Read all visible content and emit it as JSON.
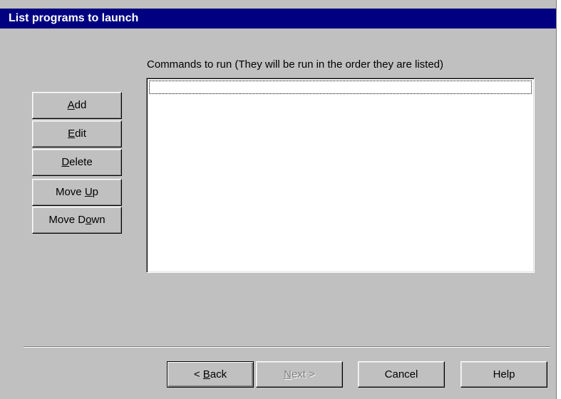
{
  "window": {
    "title": "List programs to launch"
  },
  "side_buttons": [
    {
      "pre": "",
      "ul": "A",
      "post": "dd"
    },
    {
      "pre": "",
      "ul": "E",
      "post": "dit"
    },
    {
      "pre": "",
      "ul": "D",
      "post": "elete"
    },
    {
      "pre": "Move ",
      "ul": "U",
      "post": "p"
    },
    {
      "pre": "Move D",
      "ul": "o",
      "post": "wn"
    }
  ],
  "commands": {
    "label": "Commands to run (They will be run in the order they are listed)",
    "items": []
  },
  "footer": {
    "back": {
      "pre": "< ",
      "ul": "B",
      "post": "ack"
    },
    "next": {
      "pre": "",
      "ul": "N",
      "post": "ext >"
    },
    "cancel_label": "Cancel",
    "help_label": "Help"
  }
}
